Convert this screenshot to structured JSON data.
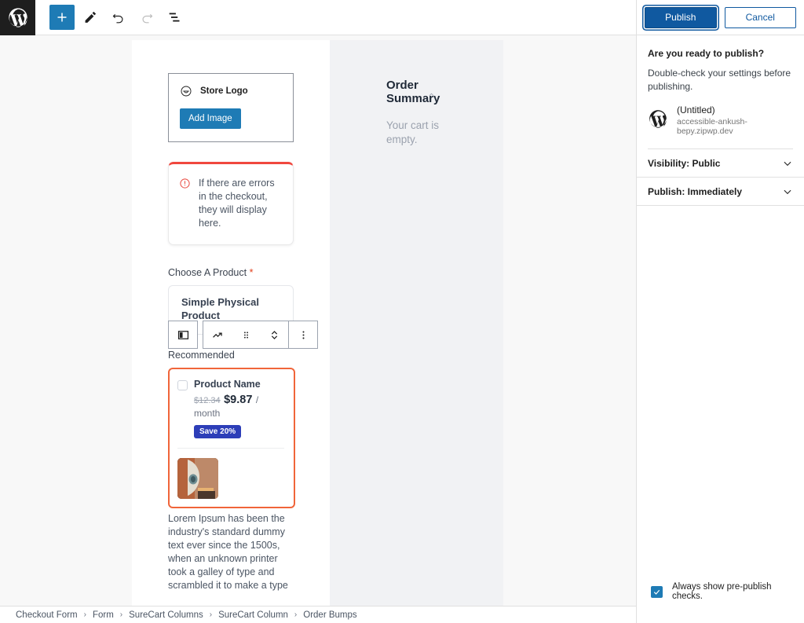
{
  "topbar": {
    "wp_logo": "wordpress-logo",
    "tools": [
      {
        "name": "add-block-button",
        "icon": "plus-icon",
        "label": "Add block"
      },
      {
        "name": "edit-tool-button",
        "icon": "pencil-icon",
        "label": "Tools"
      },
      {
        "name": "undo-button",
        "icon": "undo-icon",
        "label": "Undo"
      },
      {
        "name": "redo-button",
        "icon": "redo-icon",
        "label": "Redo",
        "disabled": true
      },
      {
        "name": "list-view-button",
        "icon": "list-view-icon",
        "label": "Document Overview"
      }
    ]
  },
  "canvas": {
    "logo_block": {
      "icon": "site-logo-icon",
      "label": "Store Logo",
      "button_label": "Add Image"
    },
    "error_notice": {
      "icon": "error-circle-icon",
      "text": "If there are errors in the checkout, they will display here."
    },
    "product_field": {
      "label": "Choose A Product",
      "required_mark": "*",
      "product_name": "Simple Physical Product"
    },
    "block_toolbar": {
      "items": [
        {
          "name": "block-type-button",
          "icon": "columns-block-icon"
        },
        {
          "name": "transform-button",
          "icon": "trending-arrow-icon"
        },
        {
          "name": "drag-handle",
          "icon": "drag-dots-icon"
        },
        {
          "name": "move-updown-button",
          "icon": "chevron-updown-icon"
        },
        {
          "name": "more-options-button",
          "icon": "vertical-ellipsis-icon"
        }
      ]
    },
    "order_bump": {
      "section_label": "Recommended",
      "title": "Product Name",
      "old_price": "$12.34",
      "new_price": "$9.87",
      "per_unit": "/ month",
      "badge": "Save 20%",
      "image_alt": "product-thumbnail",
      "description": "Lorem Ipsum has been the industry's standard dummy text ever since the 1500s, when an unknown printer took a galley of type and scrambled it to make a type"
    },
    "order_summary": {
      "title": "Order Summary",
      "collapse_icon": "chevron-up-icon",
      "empty_text": "Your cart is empty."
    }
  },
  "breadcrumb": {
    "separator": "›",
    "items": [
      "Checkout Form",
      "Form",
      "SureCart Columns",
      "SureCart Column",
      "Order Bumps"
    ]
  },
  "sidebar": {
    "publish_label": "Publish",
    "cancel_label": "Cancel",
    "heading": "Are you ready to publish?",
    "subtext": "Double-check your settings before publishing.",
    "site": {
      "icon": "wordpress-site-icon",
      "name": "(Untitled)",
      "url": "accessible-ankush-bepy.zipwp.dev"
    },
    "rows": [
      {
        "name": "visibility-row",
        "label": "Visibility: Public",
        "icon": "chevron-down-icon"
      },
      {
        "name": "publish-date-row",
        "label": "Publish: Immediately",
        "icon": "chevron-down-icon"
      }
    ],
    "prepublish_checkbox": {
      "checked": true,
      "label": "Always show pre-publish checks."
    }
  },
  "colors": {
    "accent_blue": "#1e7bb5",
    "publish_blue": "#1059a0",
    "error_red": "#f0473e",
    "bump_orange": "#f0653a",
    "badge_indigo": "#2d3eb8",
    "summary_bg": "#f1f2f4"
  }
}
